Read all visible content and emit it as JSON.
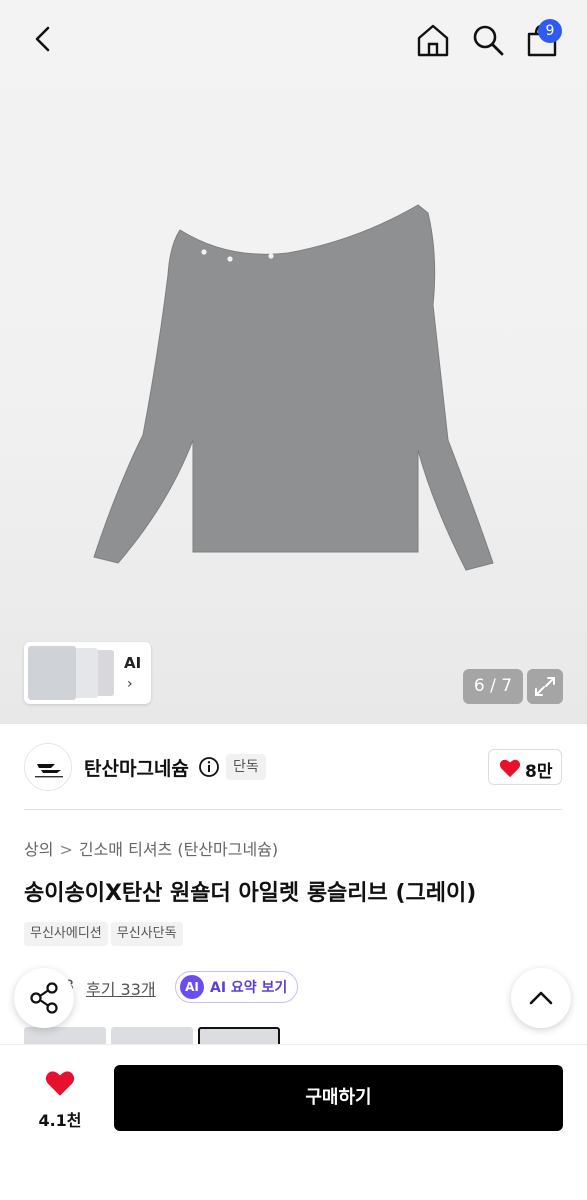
{
  "header": {
    "cart_count": "9"
  },
  "gallery": {
    "ai_label": "AI",
    "counter": "6 / 7"
  },
  "brand": {
    "name": "탄산마그네슘",
    "exclusive_badge": "단독",
    "like_count": "8만"
  },
  "breadcrumb": {
    "category": "상의",
    "subcategory": "긴소매 티셔츠 (탄산마그네슘)"
  },
  "product": {
    "title": "송이송이X탄산 원숄더 아일렛 롱슬리브 (그레이)",
    "tags": [
      "무신사에디션",
      "무신사단독"
    ]
  },
  "reviews": {
    "rating_partial": "3",
    "review_link": "후기 33개",
    "ai_chip": "AI",
    "ai_summary": "AI 요약 보기"
  },
  "bottom": {
    "wish_count": "4.1천",
    "buy_label": "구매하기"
  },
  "colors": {
    "heart": "#e8112d",
    "ai_purple": "#6a4cf2",
    "cart_badge": "#2f5bf2",
    "buy_bg": "#000000"
  }
}
